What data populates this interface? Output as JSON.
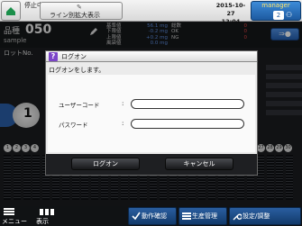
{
  "topbar": {
    "status": "停止中",
    "line_button": "ライン別拡大表示",
    "date": "2015-10-27",
    "time": "12:04",
    "user": "manager",
    "user_count": "2"
  },
  "product": {
    "label": "品種",
    "number": "050",
    "name": "sample",
    "spec_labels": [
      "基準値",
      "下限値",
      "上限値",
      "風袋値"
    ],
    "spec_values": [
      "56.1 mg",
      "-0.2 mg",
      "+0.2 mg",
      "0.0 mg"
    ],
    "count_labels": [
      "総数",
      "OK",
      "NG"
    ],
    "count_values": [
      "0",
      "0",
      "0"
    ],
    "lot_label": "ロットNo."
  },
  "dialog": {
    "title": "ログオン",
    "message": "ログオンをします。",
    "user_code_label": "ユーザーコード",
    "password_label": "パスワード",
    "colon": ":",
    "user_code_value": "",
    "password_value": "",
    "ok_label": "ログオン",
    "cancel_label": "キャンセル"
  },
  "bottombar": {
    "menu": "メニュー",
    "display": "表示",
    "btn_operation": "動作確認",
    "btn_production": "生産管理",
    "btn_settings": "設定/調整"
  },
  "meter_numbers": [
    "1",
    "2",
    "3",
    "4",
    "27",
    "28",
    "29",
    "30"
  ],
  "page_indicator": "1",
  "colors": {
    "accent": "#2a5ea0",
    "dialog_icon": "#7b45c8",
    "ng": "#d44444"
  }
}
